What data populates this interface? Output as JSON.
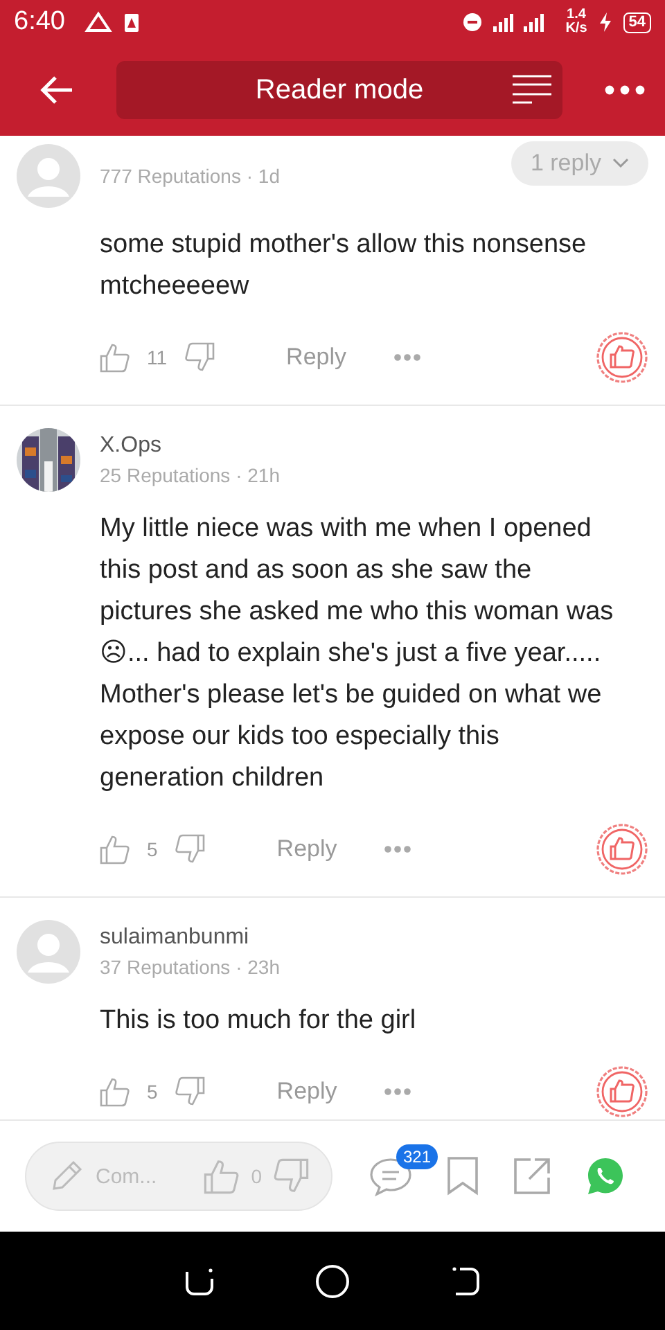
{
  "status_bar": {
    "time": "6:40",
    "speed": "1.4",
    "speed_unit": "K/s",
    "battery": "54"
  },
  "header": {
    "title": "Reader mode"
  },
  "comments": [
    {
      "avatar": {
        "kind": "default"
      },
      "meta": "777 Reputations · 1d",
      "replies": "1 reply",
      "text": "some stupid mother's allow this nonsense mtcheeeeew",
      "likes": "11",
      "reply": "Reply"
    },
    {
      "name": "X.Ops",
      "meta": "25 Reputations · 21h",
      "text": "My little niece was with me when I opened this post and as soon as she saw the pictures she asked me who this woman was☹... had to explain she's just a five year..... Mother's please let's be guided on what we expose our kids too especially this generation children",
      "likes": "5",
      "reply": "Reply"
    },
    {
      "avatar": {
        "kind": "default"
      },
      "name": "sulaimanbunmi",
      "meta": "37 Reputations · 23h",
      "text": "This is too much for the girl",
      "likes": "5",
      "reply": "Reply"
    }
  ],
  "bottom_bar": {
    "placeholder": "Com...",
    "likes": "0",
    "comment_count": "321"
  }
}
